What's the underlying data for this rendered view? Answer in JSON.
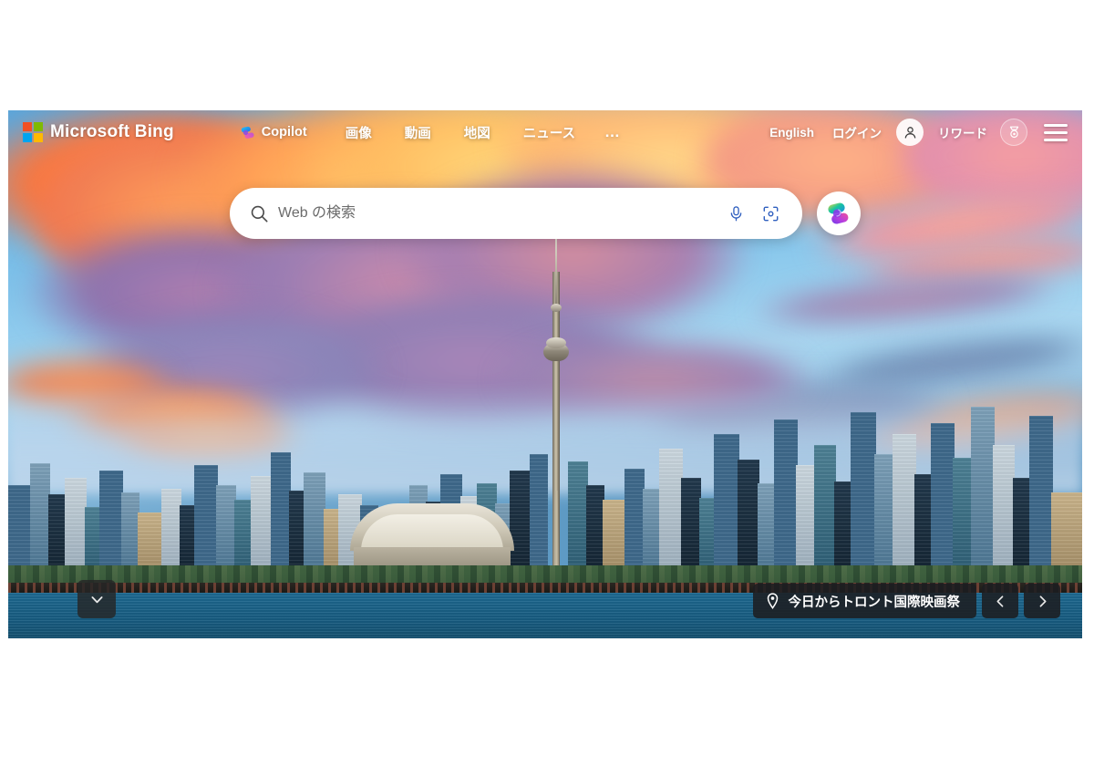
{
  "header": {
    "brand": "Microsoft Bing",
    "logo_icon": "microsoft-logo-icon",
    "copilot": {
      "label": "Copilot",
      "icon": "copilot-icon"
    },
    "nav_items": [
      {
        "label": "画像",
        "name": "images"
      },
      {
        "label": "動画",
        "name": "videos"
      },
      {
        "label": "地図",
        "name": "maps"
      },
      {
        "label": "ニュース",
        "name": "news"
      }
    ],
    "overflow_label": "…",
    "language_label": "English",
    "signin_label": "ログイン",
    "account_icon": "person-icon",
    "rewards_label": "リワード",
    "rewards_icon": "medal-icon",
    "menu_icon": "hamburger-menu-icon"
  },
  "search": {
    "placeholder": "Web の検索",
    "value": "",
    "search_icon": "search-icon",
    "mic_icon": "microphone-icon",
    "visual_search_icon": "camera-visual-search-icon",
    "copilot_button_icon": "copilot-icon"
  },
  "background": {
    "caption": "今日からトロント国際映画祭",
    "location_icon": "location-pin-icon",
    "prev_icon": "chevron-left-icon",
    "next_icon": "chevron-right-icon",
    "scroll_icon": "chevron-down-icon",
    "alt": "Toronto skyline with CN Tower at sunset"
  },
  "colors": {
    "ms_red": "#f25022",
    "ms_green": "#7fba00",
    "ms_blue": "#00a4ef",
    "ms_yellow": "#ffb900",
    "page_bg": "#ffffff",
    "caption_bg": "#1c1e21",
    "search_bg": "#ffffff"
  }
}
